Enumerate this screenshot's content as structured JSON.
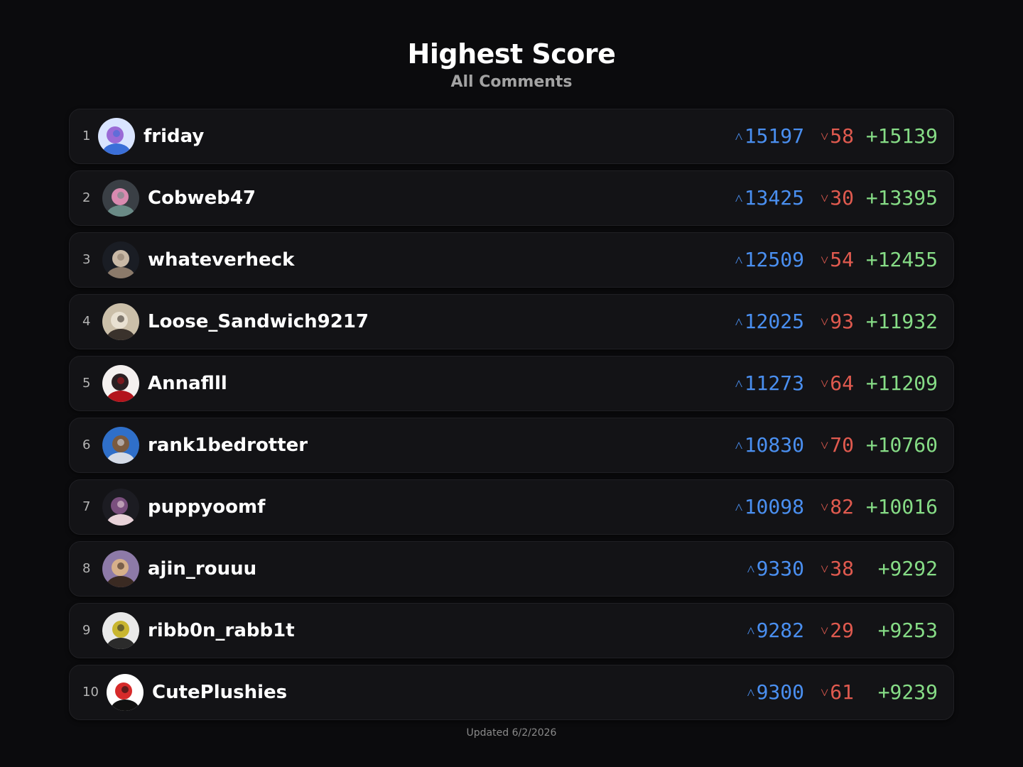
{
  "header": {
    "title": "Highest Score",
    "subtitle": "All Comments"
  },
  "leaderboard": [
    {
      "rank": "1",
      "username": "friday",
      "upvotes": "15197",
      "downvotes": "58",
      "net": "+15139",
      "avatar_colors": [
        "#d9e4ff",
        "#3b6fd8",
        "#9a6ad6"
      ]
    },
    {
      "rank": "2",
      "username": "Cobweb47",
      "upvotes": "13425",
      "downvotes": "30",
      "net": "+13395",
      "avatar_colors": [
        "#3a3f45",
        "#6a8a86",
        "#d98ab0"
      ]
    },
    {
      "rank": "3",
      "username": "whateverheck",
      "upvotes": "12509",
      "downvotes": "54",
      "net": "+12455",
      "avatar_colors": [
        "#1a1d24",
        "#8b7a6a",
        "#c9b9a6"
      ]
    },
    {
      "rank": "4",
      "username": "Loose_Sandwich9217",
      "upvotes": "12025",
      "downvotes": "93",
      "net": "+11932",
      "avatar_colors": [
        "#cbbfa9",
        "#3a322c",
        "#e9e1d2"
      ]
    },
    {
      "rank": "5",
      "username": "Annaflll",
      "upvotes": "11273",
      "downvotes": "64",
      "net": "+11209",
      "avatar_colors": [
        "#f4f0ef",
        "#b3141c",
        "#2a1f22"
      ]
    },
    {
      "rank": "6",
      "username": "rank1bedrotter",
      "upvotes": "10830",
      "downvotes": "70",
      "net": "+10760",
      "avatar_colors": [
        "#2f6fc9",
        "#d5dbe6",
        "#7a5a3f"
      ]
    },
    {
      "rank": "7",
      "username": "puppyoomf",
      "upvotes": "10098",
      "downvotes": "82",
      "net": "+10016",
      "avatar_colors": [
        "#1c1c22",
        "#e8d2d8",
        "#7a4f7e"
      ]
    },
    {
      "rank": "8",
      "username": "ajin_rouuu",
      "upvotes": "9330",
      "downvotes": "38",
      "net": "+9292",
      "avatar_colors": [
        "#8d7aa8",
        "#3a2a22",
        "#d6b08a"
      ]
    },
    {
      "rank": "9",
      "username": "ribb0n_rabb1t",
      "upvotes": "9282",
      "downvotes": "29",
      "net": "+9253",
      "avatar_colors": [
        "#e9e9e9",
        "#2b2b2b",
        "#c9b630"
      ]
    },
    {
      "rank": "10",
      "username": "CutePlushies",
      "upvotes": "9300",
      "downvotes": "61",
      "net": "+9239",
      "avatar_colors": [
        "#ffffff",
        "#111111",
        "#d62a2a"
      ]
    }
  ],
  "icons": {
    "upvote": "chevron-up-icon",
    "downvote": "chevron-down-icon"
  },
  "colors": {
    "background": "#0b0b0d",
    "row_background": "#131316",
    "upvote": "#4a8ff0",
    "downvote": "#e05a4f",
    "net": "#86dc86"
  },
  "footer": {
    "updated": "Updated 6/2/2026"
  }
}
